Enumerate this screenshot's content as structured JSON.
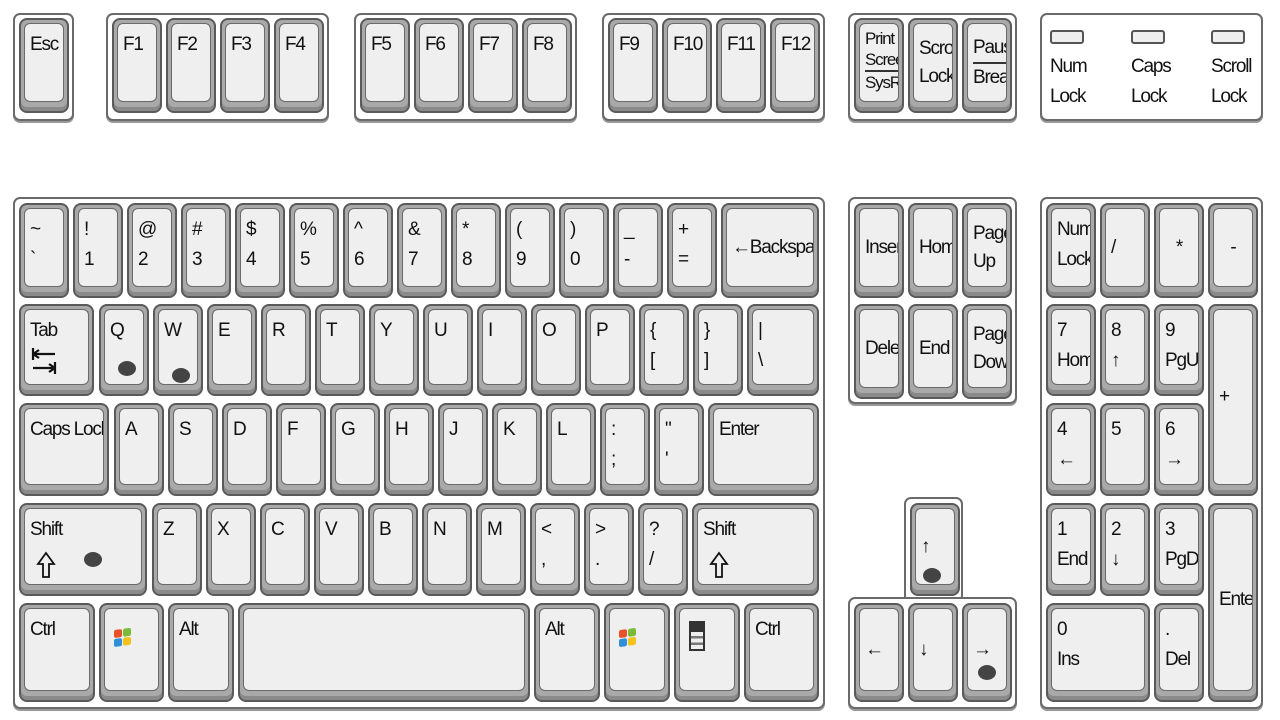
{
  "accent_colors": {
    "key_face": "#efefef",
    "key_border": "#5a5a5a",
    "marker_dot": "#444444",
    "windows_logo": [
      "#e8502a",
      "#7cbb3a",
      "#2f8fd8",
      "#f5c21b"
    ]
  },
  "leds": [
    {
      "lines": [
        "Num",
        "Lock"
      ]
    },
    {
      "lines": [
        "Caps",
        "Lock"
      ]
    },
    {
      "lines": [
        "Scroll",
        "Lock"
      ]
    }
  ],
  "keys": {
    "esc": {
      "lines": [
        "Esc"
      ]
    },
    "f1": {
      "lines": [
        "F1"
      ]
    },
    "f2": {
      "lines": [
        "F2"
      ]
    },
    "f3": {
      "lines": [
        "F3"
      ]
    },
    "f4": {
      "lines": [
        "F4"
      ]
    },
    "f5": {
      "lines": [
        "F5"
      ]
    },
    "f6": {
      "lines": [
        "F6"
      ]
    },
    "f7": {
      "lines": [
        "F7"
      ]
    },
    "f8": {
      "lines": [
        "F8"
      ]
    },
    "f9": {
      "lines": [
        "F9"
      ]
    },
    "f10": {
      "lines": [
        "F10"
      ]
    },
    "f11": {
      "lines": [
        "F11"
      ]
    },
    "f12": {
      "lines": [
        "F12"
      ]
    },
    "printscreen": {
      "lines": [
        "Print",
        "Screen",
        "SysRq"
      ]
    },
    "scrolllock": {
      "lines": [
        "Scroll",
        "Lock"
      ]
    },
    "pause": {
      "lines": [
        "Pause",
        "Break"
      ]
    },
    "backtick": {
      "lines": [
        "~",
        "`"
      ]
    },
    "1": {
      "lines": [
        "!",
        "1"
      ]
    },
    "2": {
      "lines": [
        "@",
        "2"
      ]
    },
    "3": {
      "lines": [
        "#",
        "3"
      ]
    },
    "4": {
      "lines": [
        "$",
        "4"
      ]
    },
    "5": {
      "lines": [
        "%",
        "5"
      ]
    },
    "6": {
      "lines": [
        "^",
        "6"
      ]
    },
    "7": {
      "lines": [
        "&",
        "7"
      ]
    },
    "8": {
      "lines": [
        "*",
        "8"
      ]
    },
    "9": {
      "lines": [
        "(",
        "9"
      ]
    },
    "0": {
      "lines": [
        ")",
        "0"
      ]
    },
    "minus": {
      "lines": [
        "_",
        "-"
      ]
    },
    "equals": {
      "lines": [
        "+",
        "="
      ]
    },
    "backspace": {
      "lines": [
        "←Backspace"
      ]
    },
    "tab": {
      "lines": [
        "Tab"
      ],
      "icon": "tab-arrows"
    },
    "q": {
      "lines": [
        "Q"
      ]
    },
    "w": {
      "lines": [
        "W"
      ]
    },
    "e": {
      "lines": [
        "E"
      ]
    },
    "r": {
      "lines": [
        "R"
      ]
    },
    "t": {
      "lines": [
        "T"
      ]
    },
    "y": {
      "lines": [
        "Y"
      ]
    },
    "u": {
      "lines": [
        "U"
      ]
    },
    "i": {
      "lines": [
        "I"
      ]
    },
    "o": {
      "lines": [
        "O"
      ]
    },
    "p": {
      "lines": [
        "P"
      ]
    },
    "lbracket": {
      "lines": [
        "{",
        "["
      ]
    },
    "rbracket": {
      "lines": [
        "}",
        "]"
      ]
    },
    "backslash": {
      "lines": [
        "|",
        "\\"
      ]
    },
    "capslock": {
      "lines": [
        "Caps Lock"
      ]
    },
    "a": {
      "lines": [
        "A"
      ]
    },
    "s": {
      "lines": [
        "S"
      ]
    },
    "d": {
      "lines": [
        "D"
      ]
    },
    "f": {
      "lines": [
        "F"
      ]
    },
    "g": {
      "lines": [
        "G"
      ]
    },
    "h": {
      "lines": [
        "H"
      ]
    },
    "j": {
      "lines": [
        "J"
      ]
    },
    "k": {
      "lines": [
        "K"
      ]
    },
    "l": {
      "lines": [
        "L"
      ]
    },
    "semicolon": {
      "lines": [
        ":",
        ";"
      ]
    },
    "quote": {
      "lines": [
        "\"",
        "'"
      ]
    },
    "enter": {
      "lines": [
        "Enter"
      ]
    },
    "lshift": {
      "lines": [
        "Shift"
      ],
      "icon": "shift-arrow"
    },
    "z": {
      "lines": [
        "Z"
      ]
    },
    "x": {
      "lines": [
        "X"
      ]
    },
    "c": {
      "lines": [
        "C"
      ]
    },
    "v": {
      "lines": [
        "V"
      ]
    },
    "b": {
      "lines": [
        "B"
      ]
    },
    "n": {
      "lines": [
        "N"
      ]
    },
    "m": {
      "lines": [
        "M"
      ]
    },
    "comma": {
      "lines": [
        "<",
        ","
      ]
    },
    "period": {
      "lines": [
        ">",
        "."
      ]
    },
    "slash": {
      "lines": [
        "?",
        "/"
      ]
    },
    "rshift": {
      "lines": [
        "Shift"
      ],
      "icon": "shift-arrow"
    },
    "lctrl": {
      "lines": [
        "Ctrl"
      ]
    },
    "lwin": {
      "lines": [],
      "icon": "windows-logo"
    },
    "lalt": {
      "lines": [
        "Alt"
      ]
    },
    "space": {
      "lines": []
    },
    "ralt": {
      "lines": [
        "Alt"
      ]
    },
    "rwin": {
      "lines": [],
      "icon": "windows-logo"
    },
    "menu": {
      "lines": [],
      "icon": "menu"
    },
    "rctrl": {
      "lines": [
        "Ctrl"
      ]
    },
    "insert": {
      "lines": [
        "Insert"
      ]
    },
    "home": {
      "lines": [
        "Home"
      ]
    },
    "pageup": {
      "lines": [
        "Page",
        "Up"
      ]
    },
    "delete": {
      "lines": [
        "Delete"
      ]
    },
    "end": {
      "lines": [
        "End"
      ]
    },
    "pagedown": {
      "lines": [
        "Page",
        "Down"
      ]
    },
    "up": {
      "lines": [
        "↑"
      ]
    },
    "left": {
      "lines": [
        "←"
      ]
    },
    "down": {
      "lines": [
        "↓"
      ]
    },
    "right": {
      "lines": [
        "→"
      ]
    },
    "numlock": {
      "lines": [
        "Num",
        "Lock"
      ]
    },
    "numdiv": {
      "lines": [
        "/"
      ]
    },
    "nummul": {
      "lines": [
        "*"
      ]
    },
    "numsub": {
      "lines": [
        "-"
      ]
    },
    "num7": {
      "lines": [
        "7",
        "Home"
      ]
    },
    "num8": {
      "lines": [
        "8",
        "↑"
      ]
    },
    "num9": {
      "lines": [
        "9",
        "PgUp"
      ]
    },
    "numadd": {
      "lines": [
        "+"
      ]
    },
    "num4": {
      "lines": [
        "4",
        "←"
      ]
    },
    "num5": {
      "lines": [
        "5"
      ]
    },
    "num6": {
      "lines": [
        "6",
        "→"
      ]
    },
    "num1": {
      "lines": [
        "1",
        "End"
      ]
    },
    "num2": {
      "lines": [
        "2",
        "↓"
      ]
    },
    "num3": {
      "lines": [
        "3",
        "PgDn"
      ]
    },
    "numenter": {
      "lines": [
        "Enter"
      ]
    },
    "num0": {
      "lines": [
        "0",
        "Ins"
      ]
    },
    "numdec": {
      "lines": [
        ".",
        "Del"
      ]
    }
  },
  "marked_keys": [
    "q",
    "w",
    "lshift",
    "up",
    "right"
  ]
}
